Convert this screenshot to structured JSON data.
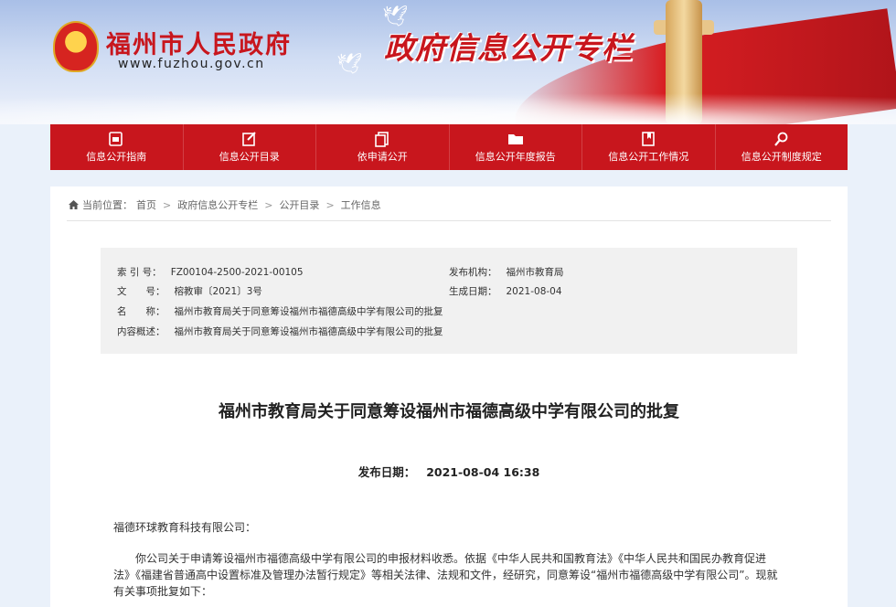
{
  "header": {
    "site_title": "福州市人民政府",
    "site_url": "www.fuzhou.gov.cn",
    "column_title": "政府信息公开专栏"
  },
  "nav": {
    "items": [
      {
        "label": "信息公开指南",
        "icon": "guide-icon"
      },
      {
        "label": "信息公开目录",
        "icon": "catalog-icon"
      },
      {
        "label": "依申请公开",
        "icon": "document-icon"
      },
      {
        "label": "信息公开年度报告",
        "icon": "folder-icon"
      },
      {
        "label": "信息公开工作情况",
        "icon": "report-icon"
      },
      {
        "label": "信息公开制度规定",
        "icon": "search-icon"
      }
    ]
  },
  "breadcrumb": {
    "prefix": "当前位置：",
    "items": [
      "首页",
      "政府信息公开专栏",
      "公开目录",
      "工作信息"
    ]
  },
  "meta": {
    "index_label": "索 引 号：",
    "index_value": "FZ00104-2500-2021-00105",
    "issuer_label": "发布机构：",
    "issuer_value": "福州市教育局",
    "docno_label": "文　　号：",
    "docno_value": "榕教审〔2021〕3号",
    "created_label": "生成日期：",
    "created_value": "2021-08-04",
    "name_label": "名　　称：",
    "name_value": "福州市教育局关于同意筹设福州市福德高级中学有限公司的批复",
    "summary_label": "内容概述：",
    "summary_value": "福州市教育局关于同意筹设福州市福德高级中学有限公司的批复"
  },
  "article": {
    "title": "福州市教育局关于同意筹设福州市福德高级中学有限公司的批复",
    "date_label": "发布日期：",
    "date_value": "2021-08-04 16:38",
    "addressee": "福德环球教育科技有限公司：",
    "paragraph": "你公司关于申请筹设福州市福德高级中学有限公司的申报材料收悉。依据《中华人民共和国教育法》《中华人民共和国民办教育促进法》《福建省普通高中设置标准及管理办法暂行规定》等相关法律、法规和文件，经研究，同意筹设“福州市福德高级中学有限公司”。现就有关事项批复如下："
  },
  "colors": {
    "brand_red": "#c8161d",
    "page_bg": "#eaf1fa",
    "meta_bg": "#f1f1f1"
  }
}
